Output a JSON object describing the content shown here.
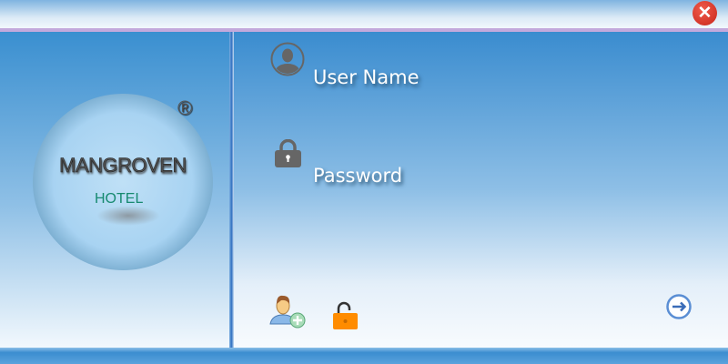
{
  "logo": {
    "brand": "MANGROVEN",
    "sub": "HOTEL",
    "mark": "®"
  },
  "form": {
    "username_label": "User Name",
    "password_label": "Password"
  },
  "window": {
    "close_glyph": "✕"
  },
  "colors": {
    "accent": "#c3a9dc",
    "primary": "#3a8ccf",
    "close": "#d93a2c",
    "unlock": "#ff8c00"
  }
}
